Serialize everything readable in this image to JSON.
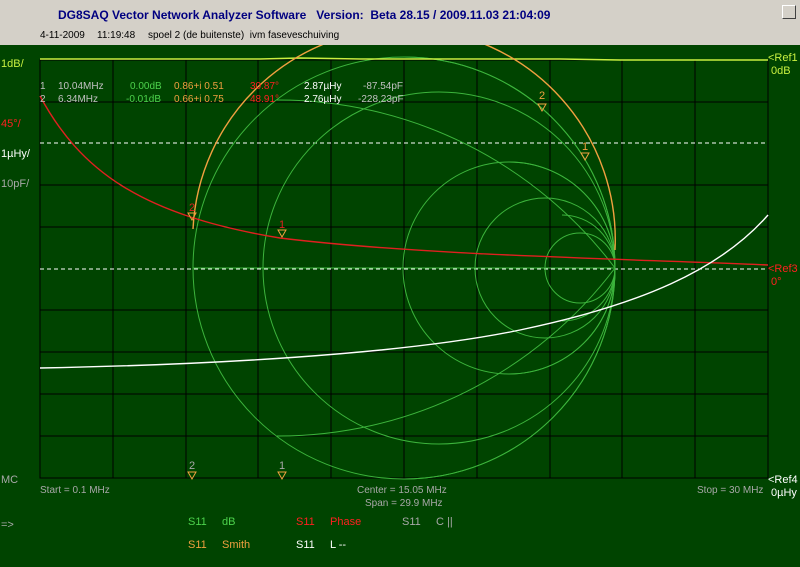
{
  "window": {
    "title": "DG8SAQ Vector Network Analyzer Software   Version:  Beta 28.15 / 2009.11.03 21:04:09",
    "date": "4-11-2009",
    "time": "11:19:48",
    "note": "spoel 2 (de buitenste)  ivm faseveschuiving"
  },
  "left_scale": {
    "db": "1dB/",
    "deg": "45°/",
    "uh": "1µHy/",
    "pf": "10pF/",
    "mc": "MC",
    "arrow": "=>"
  },
  "right_scale": {
    "ref1": "<Ref1",
    "ref1_val": "0dB",
    "ref3": "<Ref3",
    "ref3_val": "0°",
    "ref4": "<Ref4",
    "ref4_val": "0µHy"
  },
  "markers": [
    {
      "num": "1",
      "freq": "10.04MHz",
      "db": "0.00dB",
      "smith": "0.86+i 0.51",
      "phase": "30.87°",
      "l": "2.87µHy",
      "c": "-87.54pF"
    },
    {
      "num": "2",
      "freq": "6.34MHz",
      "db": "-0.01dB",
      "smith": "0.66+i 0.75",
      "phase": "48.91°",
      "l": "2.76µHy",
      "c": "-228.23pF"
    }
  ],
  "axis": {
    "start": "Start = 0.1 MHz",
    "center": "Center = 15.05 MHz",
    "span": "Span = 29.9 MHz",
    "stop": "Stop = 30 MHz"
  },
  "legend": [
    {
      "param": "S11",
      "mode": "dB",
      "color": "#4cd24c"
    },
    {
      "param": "S11",
      "mode": "Phase",
      "color": "#ff2020"
    },
    {
      "param": "S11",
      "mode": "C ||",
      "color": "#a8a8a8"
    },
    {
      "param": "S11",
      "mode": "Smith",
      "color": "#f0a040"
    },
    {
      "param": "S11",
      "mode": "L --",
      "color": "#ffffff"
    }
  ],
  "colors": {
    "background": "#004400",
    "grid": "#000000",
    "db_trace": "#c8f040",
    "phase_trace": "#e02020",
    "smith_trace": "#f0a040",
    "l_trace": "#ffffff",
    "smith_grid": "#3cb43c"
  }
}
